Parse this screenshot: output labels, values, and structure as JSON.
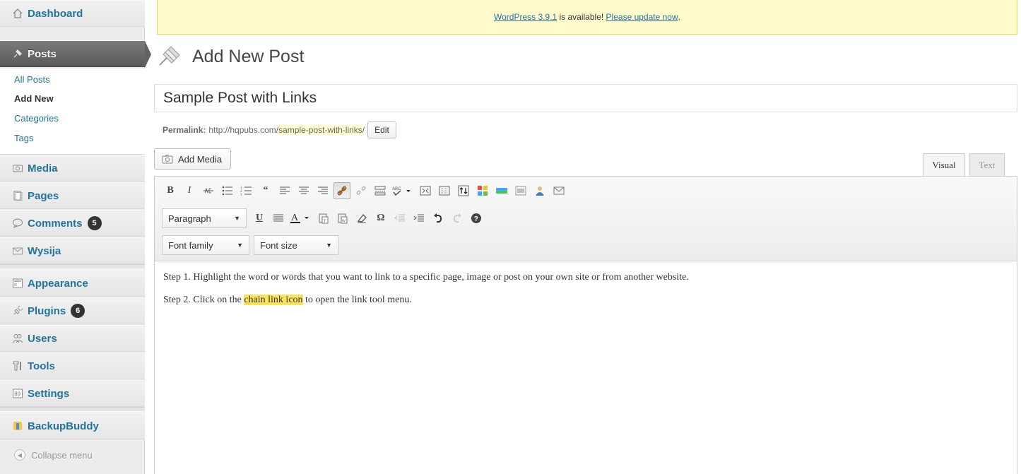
{
  "sidebar": {
    "dashboard": "Dashboard",
    "posts": "Posts",
    "submenu": {
      "all_posts": "All Posts",
      "add_new": "Add New",
      "categories": "Categories",
      "tags": "Tags"
    },
    "media": "Media",
    "pages": "Pages",
    "comments": "Comments",
    "comments_count": "5",
    "wysija": "Wysija",
    "appearance": "Appearance",
    "plugins": "Plugins",
    "plugins_count": "6",
    "users": "Users",
    "tools": "Tools",
    "settings": "Settings",
    "backupbuddy": "BackupBuddy",
    "collapse": "Collapse menu"
  },
  "notice": {
    "version_link": "WordPress 3.9.1",
    "middle": " is available! ",
    "update_link": "Please update now",
    "end": "."
  },
  "page": {
    "title": "Add New Post"
  },
  "post": {
    "title": "Sample Post with Links",
    "permalink_label": "Permalink:",
    "permalink_base": "http://hqpubs.com/",
    "permalink_slug": "sample-post-with-links",
    "permalink_trail": "/",
    "edit_label": "Edit"
  },
  "editor": {
    "add_media": "Add Media",
    "tab_visual": "Visual",
    "tab_text": "Text",
    "format_select": "Paragraph",
    "font_family_select": "Font family",
    "font_size_select": "Font size",
    "step1": "Step 1. Highlight the word or words that you want to link to a specific page, image or post on your own site or from another website.",
    "step2_before": "Step 2. Click on the ",
    "step2_highlight": "chain link icon",
    "step2_after": " to open the link tool menu."
  },
  "colors": {
    "link": "#21759b",
    "notice_bg": "#fffbcc",
    "highlight": "#fbe35a",
    "active_menu": "#5f5f5f"
  }
}
